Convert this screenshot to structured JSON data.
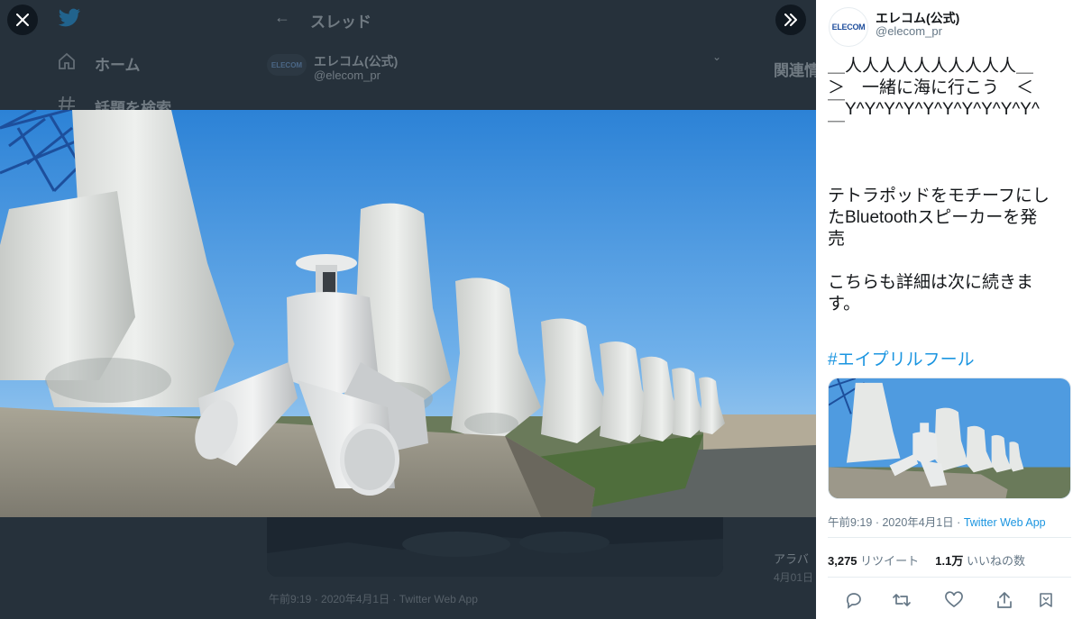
{
  "background": {
    "nav_home": "ホーム",
    "nav_explore": "話題を検索",
    "thread_header": "スレッド",
    "author_name": "エレコム(公式)",
    "author_handle": "@elecom_pr",
    "logo_text": "ELECOM",
    "trends_header": "関連情",
    "timestamp": "午前9:19 · 2020年4月1日 · Twitter Web App",
    "side_text_1": "アラバ",
    "side_text_2": "4月01日"
  },
  "icons": {
    "close": "close-icon",
    "expand": "double-chevron-right-icon",
    "reply": "reply-icon",
    "retweet": "retweet-icon",
    "like": "heart-icon",
    "share": "share-icon",
    "bookmark": "bookmark-icon"
  },
  "tweet": {
    "avatar_text": "ELECOM",
    "display_name": "エレコム(公式)",
    "handle": "@elecom_pr",
    "text_lines": [
      "＿人人人人人人人人人人＿",
      "＞　一緒に海に行こう　＜",
      "￣Y^Y^Y^Y^Y^Y^Y^Y^Y^Y^",
      "￣",
      "",
      "",
      "テトラポッドをモチーフにし",
      "たBluetoothスピーカーを発",
      "売",
      "",
      "こちらも詳細は次に続きま",
      "す。"
    ],
    "hashtag": "#エイプリルフール",
    "time": "午前9:19",
    "date": "2020年4月1日",
    "source": "Twitter Web App",
    "retweet_count": "3,275",
    "retweet_label": "リツイート",
    "like_count": "1.1万",
    "like_label": "いいねの数"
  },
  "colors": {
    "accent": "#1b95e0",
    "dim_overlay": "#26313b",
    "panel_bg": "#ffffff"
  }
}
